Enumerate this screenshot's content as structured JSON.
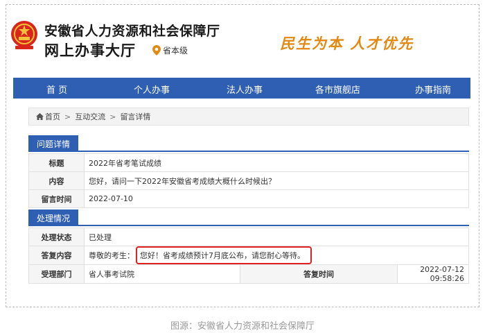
{
  "header": {
    "title_line1": "安徽省人力资源和社会保障厅",
    "title_line2": "网上办事大厅",
    "region": "省本级",
    "slogan": "民生为本  人才优先"
  },
  "nav": {
    "items": [
      "首 页",
      "个人办事",
      "法人办事",
      "各市旗舰店",
      "办事指南"
    ]
  },
  "breadcrumb": [
    "首页",
    "互动交流",
    "留言详情"
  ],
  "question_section": {
    "title": "问题详情",
    "rows": [
      {
        "label": "标题",
        "value": "2022年省考笔试成绩"
      },
      {
        "label": "内容",
        "value": "您好，请问一下2022年安徽省考成绩大概什么时候出？"
      },
      {
        "label": "留言时间",
        "value": "2022-07-10"
      }
    ]
  },
  "handling_section": {
    "title": "处理情况",
    "status_label": "处理状态",
    "status_value": "已处理",
    "reply_label": "答复内容",
    "reply_prefix": "尊敬的考生：",
    "reply_text": "您好！省考成绩预计7月底公布，请您耐心等待。",
    "dept_label": "受理部门",
    "dept_value": "省人事考试院",
    "reply_time_label": "答复时间",
    "reply_time_value": "2022-07-12 09:58:26"
  },
  "caption": "图源：安徽省人力资源和社会保障厅",
  "colors": {
    "nav_blue": "#2f5fb3",
    "slogan_orange": "#e08a14",
    "highlight_red": "#e02020"
  },
  "icons": {
    "emblem": "national-emblem-icon",
    "location": "location-pin-icon",
    "home": "home-icon"
  }
}
